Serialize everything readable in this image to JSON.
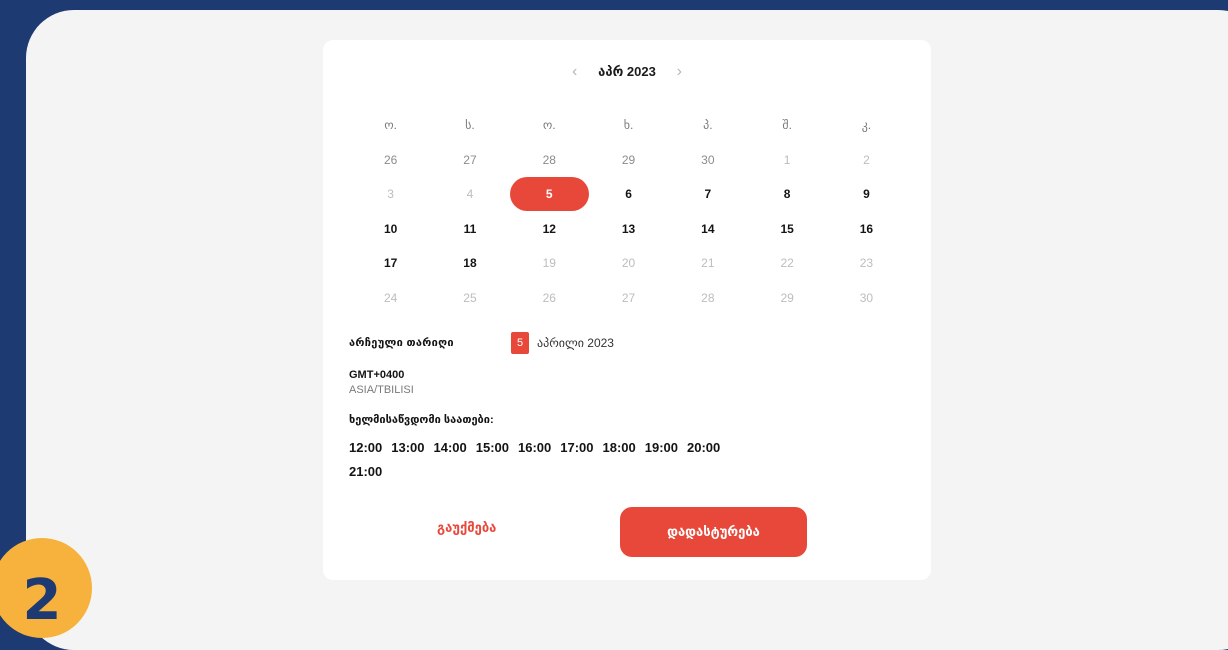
{
  "step_number": "2",
  "calendar": {
    "month_label": "აპრ 2023",
    "prev_icon": "chevron-left-icon",
    "next_icon": "chevron-right-icon",
    "weekday_headers": [
      "ო.",
      "ს.",
      "ო.",
      "ხ.",
      "პ.",
      "შ.",
      "კ."
    ],
    "weeks": [
      [
        {
          "d": "26",
          "s": "dim"
        },
        {
          "d": "27",
          "s": "dim"
        },
        {
          "d": "28",
          "s": "dim"
        },
        {
          "d": "29",
          "s": "dim"
        },
        {
          "d": "30",
          "s": "dim"
        },
        {
          "d": "1",
          "s": "muted"
        },
        {
          "d": "2",
          "s": "muted"
        }
      ],
      [
        {
          "d": "3",
          "s": "muted"
        },
        {
          "d": "4",
          "s": "muted"
        },
        {
          "d": "5",
          "s": "selected"
        },
        {
          "d": "6",
          "s": "avail"
        },
        {
          "d": "7",
          "s": "avail"
        },
        {
          "d": "8",
          "s": "avail"
        },
        {
          "d": "9",
          "s": "avail"
        }
      ],
      [
        {
          "d": "10",
          "s": "avail"
        },
        {
          "d": "11",
          "s": "avail"
        },
        {
          "d": "12",
          "s": "avail"
        },
        {
          "d": "13",
          "s": "avail"
        },
        {
          "d": "14",
          "s": "avail"
        },
        {
          "d": "15",
          "s": "avail"
        },
        {
          "d": "16",
          "s": "avail"
        }
      ],
      [
        {
          "d": "17",
          "s": "avail"
        },
        {
          "d": "18",
          "s": "avail"
        },
        {
          "d": "19",
          "s": "muted"
        },
        {
          "d": "20",
          "s": "muted"
        },
        {
          "d": "21",
          "s": "muted"
        },
        {
          "d": "22",
          "s": "muted"
        },
        {
          "d": "23",
          "s": "muted"
        }
      ],
      [
        {
          "d": "24",
          "s": "muted"
        },
        {
          "d": "25",
          "s": "muted"
        },
        {
          "d": "26",
          "s": "muted"
        },
        {
          "d": "27",
          "s": "muted"
        },
        {
          "d": "28",
          "s": "muted"
        },
        {
          "d": "29",
          "s": "muted"
        },
        {
          "d": "30",
          "s": "muted"
        }
      ]
    ]
  },
  "selected": {
    "title": "არჩეული თარიღი",
    "day": "5",
    "date_text": "აპრილი 2023"
  },
  "timezone": {
    "offset": "GMT+0400",
    "zone": "ASIA/TBILISI"
  },
  "available_title": "ხელმისაწვდომი საათები:",
  "times": [
    "12:00",
    "13:00",
    "14:00",
    "15:00",
    "16:00",
    "17:00",
    "18:00",
    "19:00",
    "20:00",
    "21:00"
  ],
  "buttons": {
    "cancel": "გაუქმება",
    "confirm": "დადასტურება"
  },
  "colors": {
    "background": "#1e3a73",
    "accent": "#e8483a",
    "badge": "#f6b23c"
  }
}
